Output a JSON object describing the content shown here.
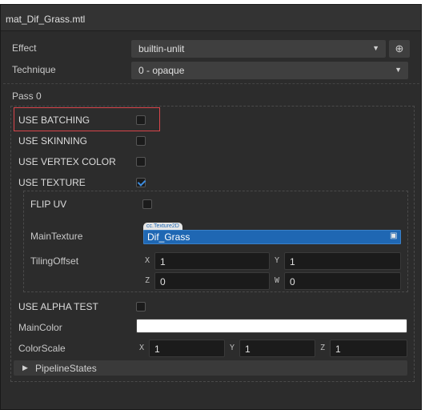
{
  "window": {
    "title": "mat_Dif_Grass.mtl"
  },
  "effect": {
    "label": "Effect",
    "value": "builtin-unlit",
    "locate_icon": "crosshair-icon"
  },
  "technique": {
    "label": "Technique",
    "value": "0 - opaque"
  },
  "pass": {
    "label": "Pass 0"
  },
  "defines": {
    "use_batching": {
      "label": "USE BATCHING",
      "checked": false
    },
    "use_skinning": {
      "label": "USE SKINNING",
      "checked": false
    },
    "use_vertex_color": {
      "label": "USE VERTEX COLOR",
      "checked": false
    },
    "use_texture": {
      "label": "USE TEXTURE",
      "checked": true
    },
    "use_alpha_test": {
      "label": "USE ALPHA TEST",
      "checked": false
    }
  },
  "texture_group": {
    "flip_uv": {
      "label": "FLIP UV",
      "checked": false
    },
    "main_texture": {
      "label": "MainTexture",
      "type_tag": "cc.Texture2D",
      "value": "Dif_Grass"
    },
    "tiling_offset": {
      "label": "TilingOffset",
      "x_label": "X",
      "x": "1",
      "y_label": "Y",
      "y": "1",
      "z_label": "Z",
      "z": "0",
      "w_label": "W",
      "w": "0"
    }
  },
  "main_color": {
    "label": "MainColor",
    "value": "#ffffff"
  },
  "color_scale": {
    "label": "ColorScale",
    "x_label": "X",
    "x": "1",
    "y_label": "Y",
    "y": "1",
    "z_label": "Z",
    "z": "1"
  },
  "pipeline_states": {
    "label": "PipelineStates"
  },
  "colors": {
    "panel_bg": "#2c2c2c",
    "accent": "#1f67b3",
    "highlight": "#d9454b",
    "check": "#3d8de0"
  }
}
